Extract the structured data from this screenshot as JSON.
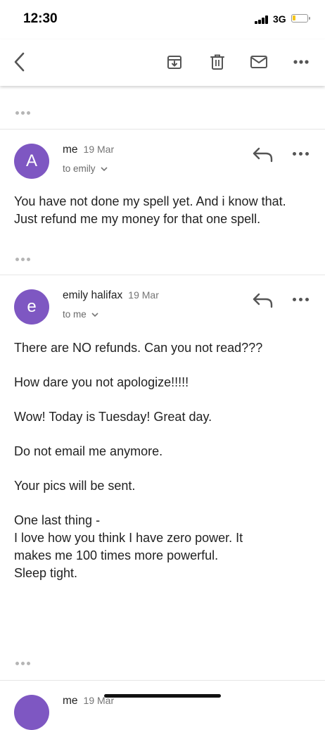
{
  "status_bar": {
    "time": "12:30",
    "network": "3G",
    "battery_level": 0.2
  },
  "toolbar": {
    "back_icon": "back-arrow-icon",
    "archive_icon": "archive-icon",
    "delete_icon": "trash-icon",
    "mark_unread_icon": "mail-icon",
    "more_icon": "more-icon"
  },
  "colors": {
    "avatar": "#7e57c2",
    "accent_text": "#222222",
    "muted_text": "#757575"
  },
  "messages": [
    {
      "avatar_letter": "A",
      "sender": "me",
      "date": "19 Mar",
      "recipient": "to emily",
      "body": "You have not done my spell yet. And i know that. Just refund me my money for that one spell."
    },
    {
      "avatar_letter": "e",
      "sender": "emily halifax",
      "date": "19 Mar",
      "recipient": "to me",
      "body_lines": [
        "There are NO refunds. Can you not read???",
        "How dare you not apologize!!!!!",
        "Wow! Today is Tuesday! Great day.",
        "Do not email me anymore.",
        "Your pics will be sent.",
        "One last thing -",
        "I love how you think I have zero power. It makes me 100 times more powerful.",
        "Sleep tight."
      ]
    },
    {
      "sender": "me",
      "date": "19 Mar"
    }
  ]
}
